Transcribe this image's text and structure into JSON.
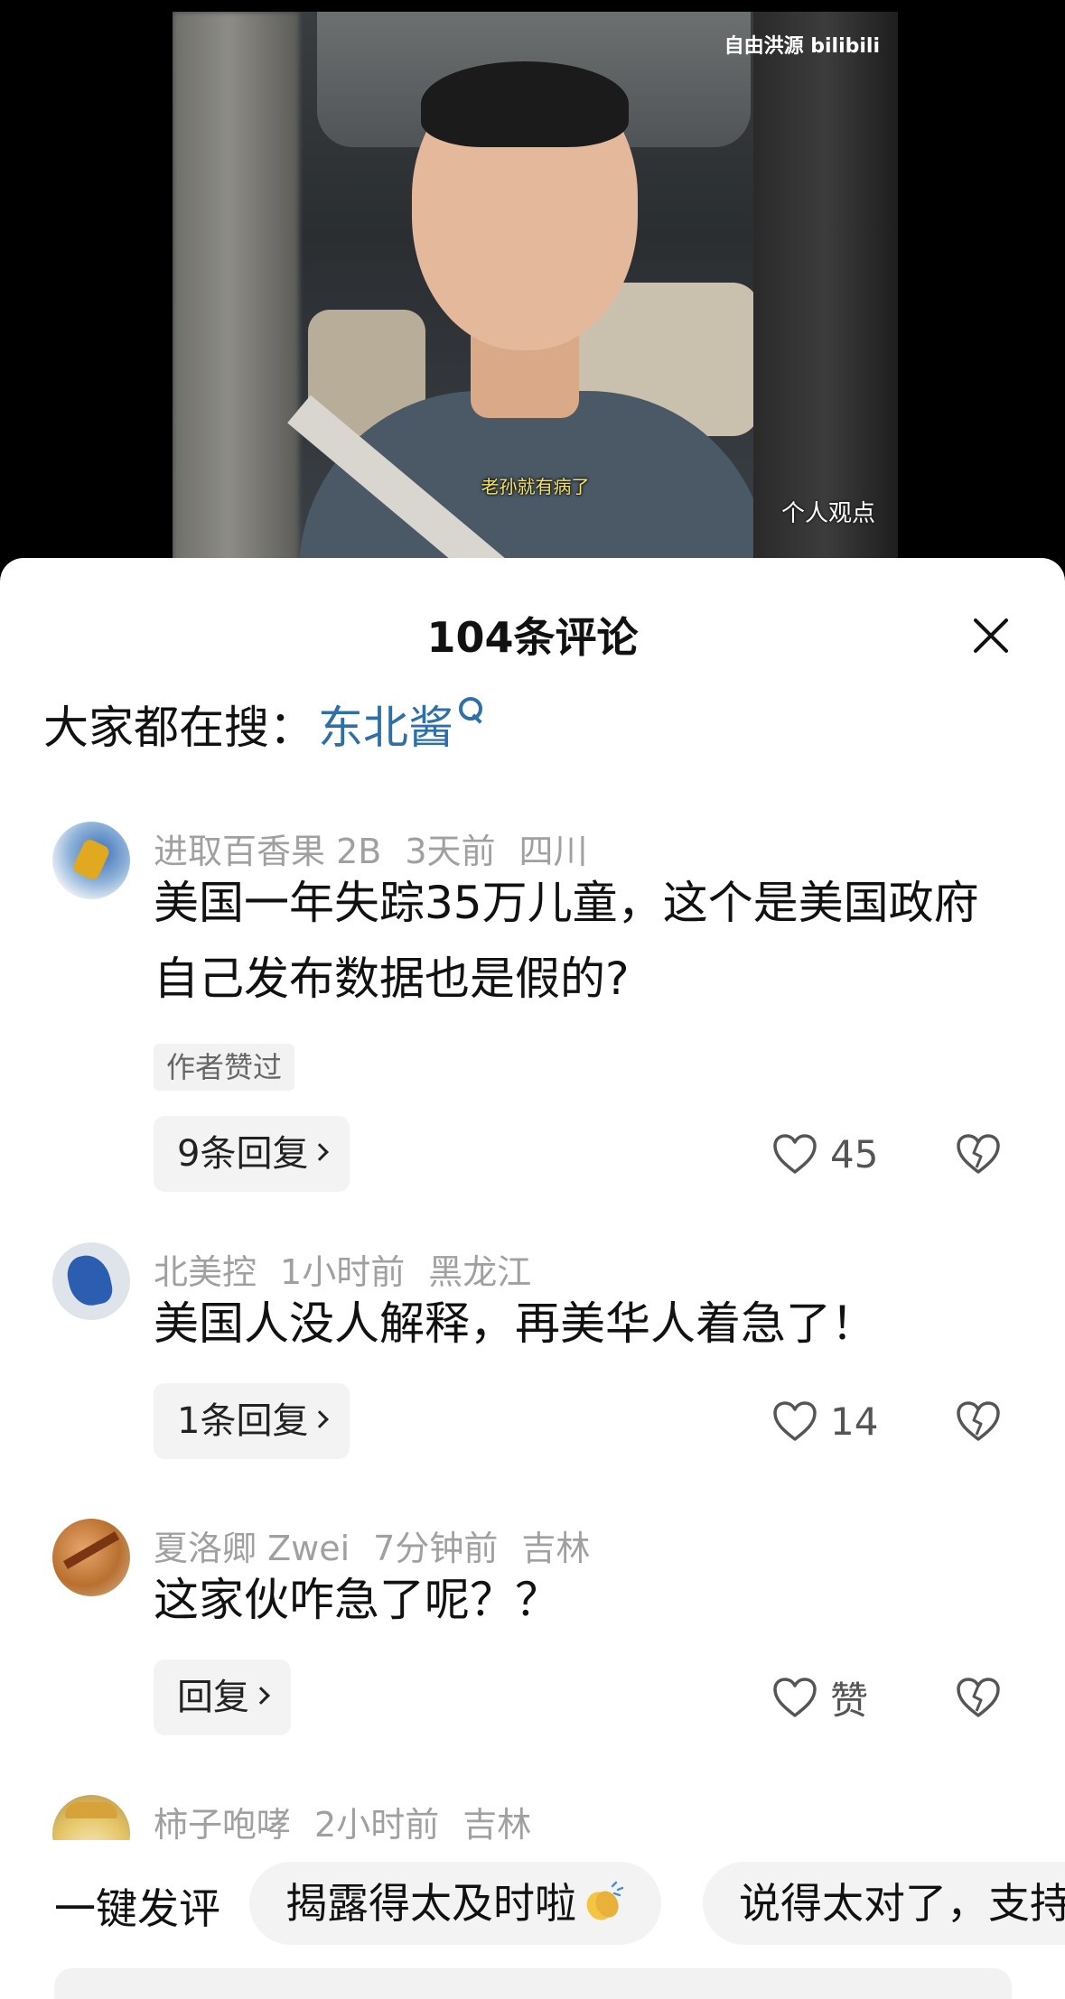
{
  "video": {
    "watermark": "自由洪源 bilibili",
    "subtitle": "老孙就有病了",
    "overlay_label": "个人观点"
  },
  "comments_panel": {
    "title": "104条评论",
    "search_prefix": "大家都在搜：",
    "search_term": "东北酱",
    "comments": [
      {
        "user": "进取百香果 2B",
        "time": "3天前",
        "location": "四川",
        "text": "美国一年失踪35万儿童，这个是美国政府自己发布数据也是假的?",
        "author_liked": "作者赞过",
        "replies": "9条回复",
        "likes": "45"
      },
      {
        "user": "北美控",
        "time": "1小时前",
        "location": "黑龙江",
        "text": "美国人没人解释，再美华人着急了！",
        "replies": "1条回复",
        "likes": "14"
      },
      {
        "user": "夏洛卿 Zwei",
        "time": "7分钟前",
        "location": "吉林",
        "text": "这家伙咋急了呢？？",
        "replies": "回复",
        "likes": "赞"
      },
      {
        "user": "柿子咆哮",
        "time": "2小时前",
        "location": "吉林"
      }
    ],
    "quick_comment_label": "一键发评",
    "quick_chips": [
      "揭露得太及时啦",
      "说得太对了，支持"
    ]
  }
}
